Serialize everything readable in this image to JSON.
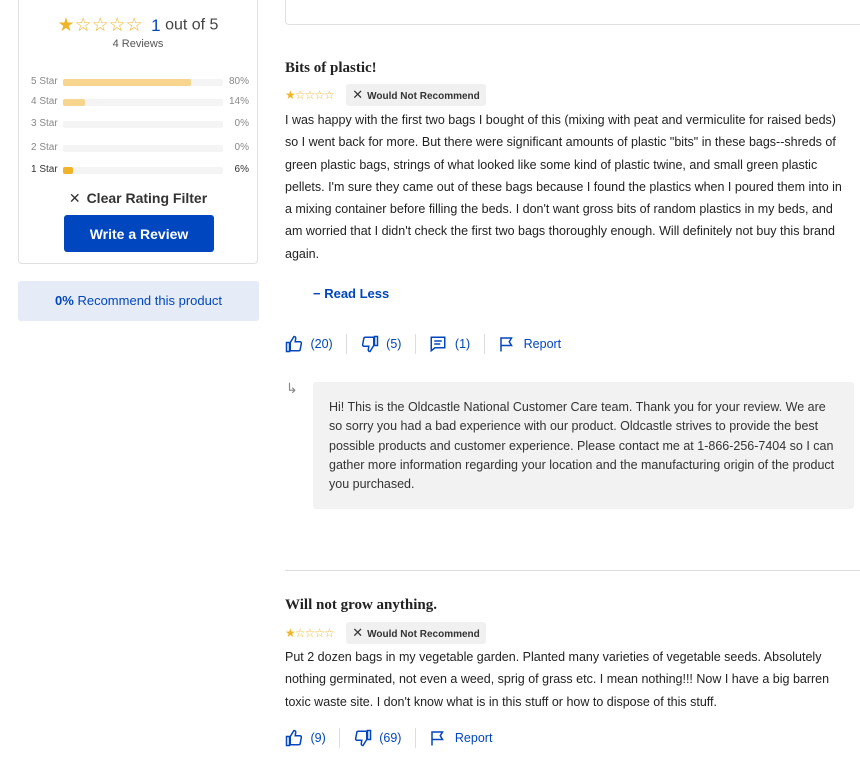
{
  "summary": {
    "avg_stars": "★☆☆☆☆",
    "avg_value": "1",
    "avg_suffix": "out of 5",
    "reviews_count": "4 Reviews",
    "histogram": [
      {
        "label": "5 Star",
        "pct": "80%",
        "fraction": 0.8,
        "active": false
      },
      {
        "label": "4 Star",
        "pct": "14%",
        "fraction": 0.14,
        "active": false
      },
      {
        "label": "3 Star",
        "pct": "0%",
        "fraction": 0.0,
        "active": false
      },
      {
        "label": "2 Star",
        "pct": "0%",
        "fraction": 0.0,
        "active": false
      },
      {
        "label": "1 Star",
        "pct": "6%",
        "fraction": 0.06,
        "active": true
      }
    ],
    "clear_filter_icon": "✕",
    "clear_filter_label": "Clear Rating Filter",
    "write_review_label": "Write a Review"
  },
  "recommend": {
    "pct": "0%",
    "label": "Recommend this product"
  },
  "reviews": [
    {
      "title": "Bits of plastic!",
      "stars": "★☆☆☆☆",
      "badge_icon": "✕",
      "badge": "Would Not Recommend",
      "body": "I was happy with the first two bags I bought of this (mixing with peat and vermiculite for raised beds) so I went back for more. But there were significant amounts of plastic \"bits\" in these bags--shreds of green plastic bags, strings of what looked like some kind of plastic twine, and small green plastic pellets. I'm sure they came out of these bags because I found the plastics when I poured them into in a mixing container before filling the beds. I don't want gross bits of random plastics in my beds, and am worried that I didn't check the first two bags thoroughly enough. Will definitely not buy this brand again.",
      "read_less": "− Read Less",
      "helpful": "(20)",
      "unhelpful": "(5)",
      "comments": "(1)",
      "report": "Report",
      "reply_arrow": "↳",
      "reply": "Hi! This is the Oldcastle National Customer Care team. Thank you for your review. We are so sorry you had a bad experience with our product. Oldcastle strives to provide the best possible products and customer experience. Please contact me at 1-866-256-7404 so I can gather more information regarding your location and the manufacturing origin of the product you purchased."
    },
    {
      "title": "Will not grow anything.",
      "stars": "★☆☆☆☆",
      "badge_icon": "✕",
      "badge": "Would Not Recommend",
      "body": "Put 2 dozen bags in my vegetable garden. Planted many varieties of vegetable seeds. Absolutely nothing germinated, not even a weed, sprig of grass etc. I mean nothing!!! Now I have a big barren toxic waste site. I don't know what is in this stuff or how to dispose of this stuff.",
      "helpful": "(9)",
      "unhelpful": "(69)",
      "report": "Report"
    }
  ],
  "colors": {
    "accent": "#0046be",
    "star": "#f0b429",
    "bar_light": "#f7d58f"
  }
}
